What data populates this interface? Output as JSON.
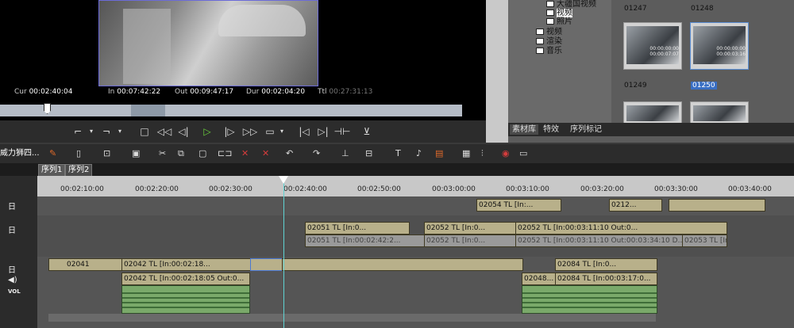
{
  "player": {
    "cur_label": "Cur",
    "cur": "00:02:40:04",
    "in_label": "In",
    "in": "00:07:42:22",
    "out_label": "Out",
    "out": "00:09:47:17",
    "dur_label": "Dur",
    "dur": "00:02:04:20",
    "ttl_label": "Ttl",
    "ttl": "00:27:31:13"
  },
  "bin": {
    "tree": [
      "大疆国视频",
      "视频",
      "照片",
      "视频",
      "渲染",
      "音乐"
    ],
    "thumbs": [
      {
        "label": "01247",
        "tc1": "",
        "tc2": ""
      },
      {
        "label": "01248",
        "tc1": "",
        "tc2": ""
      },
      {
        "label": "01249",
        "tc1": "00:00:00:00",
        "tc2": "00:00:07:07"
      },
      {
        "label": "01250",
        "tc1": "00:00:00:00",
        "tc2": "00:00:03:16"
      }
    ],
    "tabs": [
      "素材库",
      "特效",
      "序列标记"
    ]
  },
  "toolbar": {
    "left_label": "威力狮四..."
  },
  "sequence": {
    "tabs": [
      "序列1",
      "序列2"
    ]
  },
  "ruler": {
    "ticks": [
      "00:02:10:00",
      "00:02:20:00",
      "00:02:30:00",
      "00:02:40:00",
      "00:02:50:00",
      "00:03:00:00",
      "00:03:10:00",
      "00:03:20:00",
      "00:03:30:00",
      "00:03:40:00"
    ]
  },
  "tracks": {
    "v3_clips": [
      {
        "label": "02054  TL [In:..."
      },
      {
        "label": "0212..."
      }
    ],
    "v2_clips": [
      {
        "label": "02051  TL [In:0..."
      },
      {
        "label": "02052  TL [In:0..."
      },
      {
        "label": "02052  TL [In:00:03:11:10 Out:0..."
      },
      {
        "label": "02051  TL [In:00:02:42:2..."
      },
      {
        "label": "02052  TL [In:0..."
      },
      {
        "label": "02052  TL [In:00:03:11:10 Out:00:03:34:10 D..."
      },
      {
        "label": "02053  TL [In:0..."
      }
    ],
    "v1_clips": [
      {
        "label": "02041"
      },
      {
        "label": "02042  TL [In:00:02:18..."
      },
      {
        "label": "02084  TL [In:0..."
      }
    ],
    "a1_clips": [
      {
        "label": "02042  TL [In:00:02:18:05 Out:0..."
      },
      {
        "label": "02048..."
      },
      {
        "label": "02084  TL [In:00:03:17:0..."
      }
    ],
    "hdr_vol": "VOL"
  }
}
